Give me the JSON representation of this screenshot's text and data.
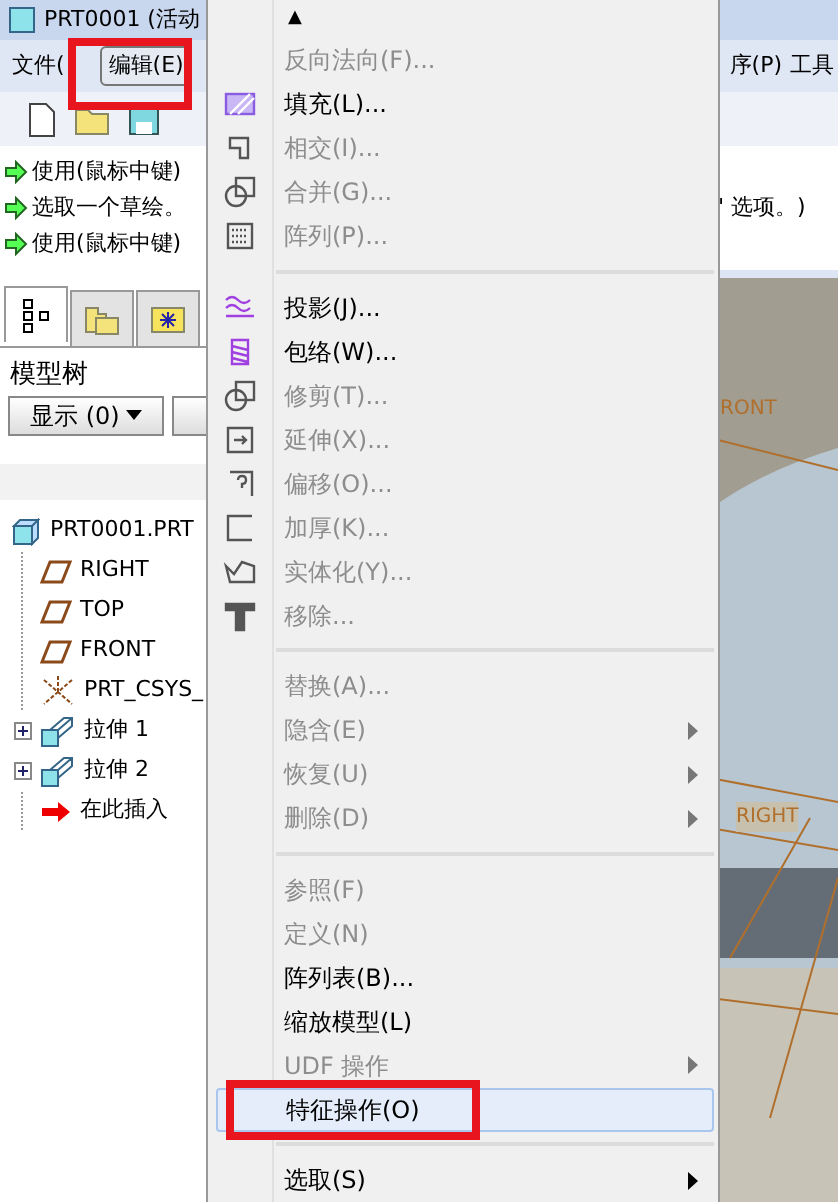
{
  "window": {
    "title": "PRT0001 (活动"
  },
  "menu_bar": [
    {
      "label": "文件(",
      "open": false
    },
    {
      "label": "编辑(E)",
      "open": true,
      "annotated": true
    },
    {
      "label": "序(P)",
      "open": false
    },
    {
      "label": "工具",
      "open": false
    }
  ],
  "messages": [
    {
      "text": "使用(鼠标中键)"
    },
    {
      "text": "选取一个草绘。",
      "tail": "\" 选项。)"
    },
    {
      "text": "使用(鼠标中键)"
    }
  ],
  "navigator_tabs": [
    {
      "selected": true
    },
    {
      "selected": false
    },
    {
      "selected": false
    }
  ],
  "model_tree": {
    "title": "模型树",
    "show_button": "显示 (0)"
  },
  "tree": [
    {
      "label": "PRT0001.PRT",
      "kind": "part",
      "children": [
        {
          "label": "RIGHT",
          "kind": "plane",
          "expandable": false
        },
        {
          "label": "TOP",
          "kind": "plane",
          "expandable": false
        },
        {
          "label": "FRONT",
          "kind": "plane",
          "expandable": false
        },
        {
          "label": "PRT_CSYS_",
          "kind": "csys",
          "expandable": false
        },
        {
          "label": "拉伸 1",
          "kind": "extrude",
          "expandable": true
        },
        {
          "label": "拉伸 2",
          "kind": "extrude",
          "expandable": true
        },
        {
          "label": "在此插入",
          "kind": "insert",
          "expandable": false
        }
      ]
    }
  ],
  "edit_menu": [
    {
      "kind": "scroll",
      "label": "▲"
    },
    {
      "kind": "item",
      "label": "反向法向(F)...",
      "disabled": true,
      "submenu": false,
      "selected": false,
      "annotated": false
    },
    {
      "kind": "item",
      "label": "填充(L)...",
      "disabled": false,
      "submenu": false,
      "selected": false,
      "annotated": false
    },
    {
      "kind": "item",
      "label": "相交(I)...",
      "disabled": true,
      "submenu": false,
      "selected": false,
      "annotated": false
    },
    {
      "kind": "item",
      "label": "合并(G)...",
      "disabled": true,
      "submenu": false,
      "selected": false,
      "annotated": false
    },
    {
      "kind": "item",
      "label": "阵列(P)...",
      "disabled": true,
      "submenu": false,
      "selected": false,
      "annotated": false
    },
    {
      "kind": "separator"
    },
    {
      "kind": "item",
      "label": "投影(J)...",
      "disabled": false,
      "submenu": false,
      "selected": false,
      "annotated": false
    },
    {
      "kind": "item",
      "label": "包络(W)...",
      "disabled": false,
      "submenu": false,
      "selected": false,
      "annotated": false
    },
    {
      "kind": "item",
      "label": "修剪(T)...",
      "disabled": true,
      "submenu": false,
      "selected": false,
      "annotated": false
    },
    {
      "kind": "item",
      "label": "延伸(X)...",
      "disabled": true,
      "submenu": false,
      "selected": false,
      "annotated": false
    },
    {
      "kind": "item",
      "label": "偏移(O)...",
      "disabled": true,
      "submenu": false,
      "selected": false,
      "annotated": false
    },
    {
      "kind": "item",
      "label": "加厚(K)...",
      "disabled": true,
      "submenu": false,
      "selected": false,
      "annotated": false
    },
    {
      "kind": "item",
      "label": "实体化(Y)...",
      "disabled": true,
      "submenu": false,
      "selected": false,
      "annotated": false
    },
    {
      "kind": "item",
      "label": "移除...",
      "disabled": true,
      "submenu": false,
      "selected": false,
      "annotated": false
    },
    {
      "kind": "separator"
    },
    {
      "kind": "item",
      "label": "替换(A)...",
      "disabled": true,
      "submenu": false,
      "selected": false,
      "annotated": false
    },
    {
      "kind": "item",
      "label": "隐含(E)",
      "disabled": true,
      "submenu": true,
      "selected": false,
      "annotated": false
    },
    {
      "kind": "item",
      "label": "恢复(U)",
      "disabled": true,
      "submenu": true,
      "selected": false,
      "annotated": false
    },
    {
      "kind": "item",
      "label": "删除(D)",
      "disabled": true,
      "submenu": true,
      "selected": false,
      "annotated": false
    },
    {
      "kind": "separator"
    },
    {
      "kind": "item",
      "label": "参照(F)",
      "disabled": true,
      "submenu": false,
      "selected": false,
      "annotated": false
    },
    {
      "kind": "item",
      "label": "定义(N)",
      "disabled": true,
      "submenu": false,
      "selected": false,
      "annotated": false
    },
    {
      "kind": "item",
      "label": "阵列表(B)...",
      "disabled": false,
      "submenu": false,
      "selected": false,
      "annotated": false
    },
    {
      "kind": "item",
      "label": "缩放模型(L)",
      "disabled": false,
      "submenu": false,
      "selected": false,
      "annotated": false
    },
    {
      "kind": "item",
      "label": "UDF 操作",
      "disabled": true,
      "submenu": true,
      "selected": false,
      "annotated": false
    },
    {
      "kind": "item",
      "label": "特征操作(O)",
      "disabled": false,
      "submenu": false,
      "selected": true,
      "annotated": true
    },
    {
      "kind": "separator"
    },
    {
      "kind": "item",
      "label": "选取(S)",
      "disabled": false,
      "submenu": true,
      "selected": false,
      "annotated": false
    }
  ],
  "graphics": {
    "labels": [
      "RONT",
      "RIGHT"
    ]
  }
}
